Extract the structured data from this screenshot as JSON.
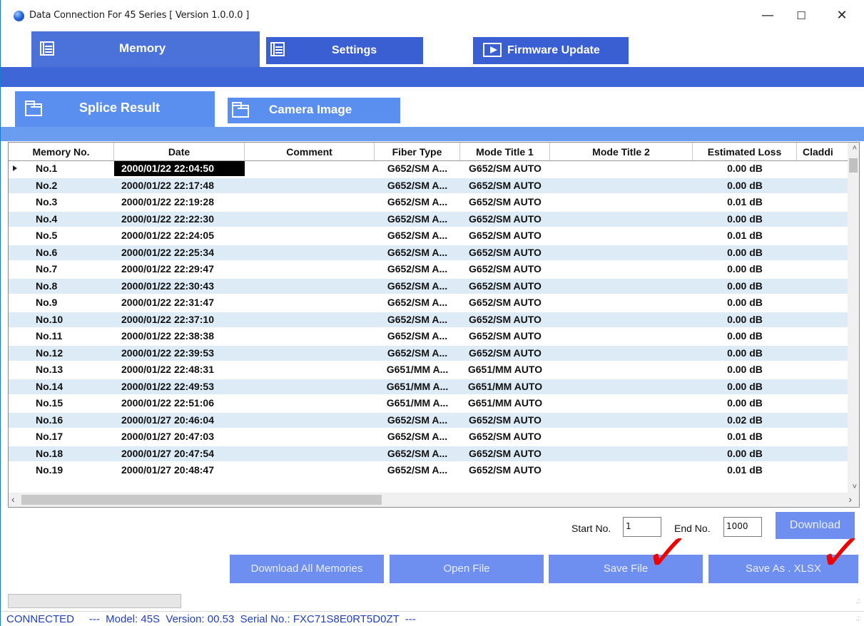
{
  "window": {
    "title": "Data Connection For 45 Series [ Version 1.0.0.0 ]",
    "min_glyph": "—",
    "max_glyph": "☐",
    "close_glyph": "✕"
  },
  "tabs": {
    "memory": "Memory",
    "settings": "Settings",
    "firmware": "Firmware Update"
  },
  "subtabs": {
    "splice": "Splice Result",
    "camera": "Camera Image"
  },
  "table": {
    "columns": [
      "Memory No.",
      "Date",
      "Comment",
      "Fiber Type",
      "Mode Title 1",
      "Mode Title 2",
      "Estimated Loss",
      "Claddi"
    ],
    "rows": [
      [
        "No.1",
        "2000/01/22 22:04:50",
        "",
        "G652/SM A...",
        "G652/SM AUTO",
        "",
        "0.00 dB",
        ""
      ],
      [
        "No.2",
        "2000/01/22 22:17:48",
        "",
        "G652/SM A...",
        "G652/SM AUTO",
        "",
        "0.00 dB",
        ""
      ],
      [
        "No.3",
        "2000/01/22 22:19:28",
        "",
        "G652/SM A...",
        "G652/SM AUTO",
        "",
        "0.01 dB",
        ""
      ],
      [
        "No.4",
        "2000/01/22 22:22:30",
        "",
        "G652/SM A...",
        "G652/SM AUTO",
        "",
        "0.00 dB",
        ""
      ],
      [
        "No.5",
        "2000/01/22 22:24:05",
        "",
        "G652/SM A...",
        "G652/SM AUTO",
        "",
        "0.01 dB",
        ""
      ],
      [
        "No.6",
        "2000/01/22 22:25:34",
        "",
        "G652/SM A...",
        "G652/SM AUTO",
        "",
        "0.00 dB",
        ""
      ],
      [
        "No.7",
        "2000/01/22 22:29:47",
        "",
        "G652/SM A...",
        "G652/SM AUTO",
        "",
        "0.00 dB",
        ""
      ],
      [
        "No.8",
        "2000/01/22 22:30:43",
        "",
        "G652/SM A...",
        "G652/SM AUTO",
        "",
        "0.00 dB",
        ""
      ],
      [
        "No.9",
        "2000/01/22 22:31:47",
        "",
        "G652/SM A...",
        "G652/SM AUTO",
        "",
        "0.00 dB",
        ""
      ],
      [
        "No.10",
        "2000/01/22 22:37:10",
        "",
        "G652/SM A...",
        "G652/SM AUTO",
        "",
        "0.00 dB",
        ""
      ],
      [
        "No.11",
        "2000/01/22 22:38:38",
        "",
        "G652/SM A...",
        "G652/SM AUTO",
        "",
        "0.00 dB",
        ""
      ],
      [
        "No.12",
        "2000/01/22 22:39:53",
        "",
        "G652/SM A...",
        "G652/SM AUTO",
        "",
        "0.00 dB",
        ""
      ],
      [
        "No.13",
        "2000/01/22 22:48:31",
        "",
        "G651/MM A...",
        "G651/MM AUTO",
        "",
        "0.00 dB",
        ""
      ],
      [
        "No.14",
        "2000/01/22 22:49:53",
        "",
        "G651/MM A...",
        "G651/MM AUTO",
        "",
        "0.00 dB",
        ""
      ],
      [
        "No.15",
        "2000/01/22 22:51:06",
        "",
        "G651/MM A...",
        "G651/MM AUTO",
        "",
        "0.00 dB",
        ""
      ],
      [
        "No.16",
        "2000/01/27 20:46:04",
        "",
        "G652/SM A...",
        "G652/SM AUTO",
        "",
        "0.02 dB",
        ""
      ],
      [
        "No.17",
        "2000/01/27 20:47:03",
        "",
        "G652/SM A...",
        "G652/SM AUTO",
        "",
        "0.01 dB",
        ""
      ],
      [
        "No.18",
        "2000/01/27 20:47:54",
        "",
        "G652/SM A...",
        "G652/SM AUTO",
        "",
        "0.00 dB",
        ""
      ],
      [
        "No.19",
        "2000/01/27 20:48:47",
        "",
        "G652/SM A...",
        "G652/SM AUTO",
        "",
        "0.01 dB",
        ""
      ]
    ],
    "selected_row": 0
  },
  "range": {
    "start_label": "Start No.",
    "start_value": "1",
    "end_label": "End No.",
    "end_value": "1000",
    "download": "Download"
  },
  "buttons": {
    "download_all": "Download All Memories",
    "open_file": "Open File",
    "save_file": "Save File",
    "save_xlsx": "Save As . XLSX"
  },
  "annotation": {
    "checkmark": "✓",
    "color": "#ee0000"
  },
  "status": {
    "connection": "CONNECTED",
    "details": "---  Model: 45S  Version: 00.53  Serial No.: FXC71S8E0RT5D0ZT  ---"
  },
  "colors": {
    "tab_blue": "#3a5fd2",
    "subtab_blue": "#5a8ff0",
    "button_blue": "#6f8ff0",
    "row_alt": "#ddebf7",
    "status_text": "#1f3fbf"
  }
}
